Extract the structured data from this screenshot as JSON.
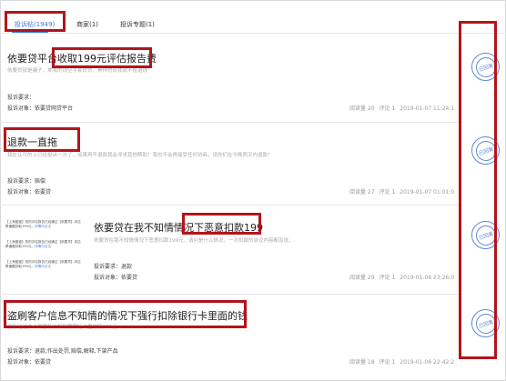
{
  "tabs": [
    {
      "label": "投诉帖(1949)",
      "active": true
    },
    {
      "label": "商家(1)",
      "active": false
    },
    {
      "label": "投诉专题(1)",
      "active": false
    }
  ],
  "complaints": [
    {
      "title": "依要贷平台收取199元评估报告费",
      "summary": "依要贷就是骗子，拿我的钱空手套白贷，骨样的说我就不给退钱",
      "demand": "投诉要求：",
      "target": "投诉对象：依要贷网贷平台",
      "views": "阅读量 20",
      "comments": "评论 1",
      "time": "2019-01-07 11:24:1",
      "stamp": "已回复"
    },
    {
      "title": "退款一直拖",
      "summary": "我在认可的上已经投诉一次了，如果再不退款我会寻求其他帮助！我也不会再接受任何协商，请你们在今晚两天内退款！",
      "demand": "投诉要求：赔偿",
      "target": "投诉对象：依要贷",
      "views": "阅读量 27",
      "comments": "评论 1",
      "time": "2019-01-07 01:01:0",
      "stamp": "已回复"
    },
    {
      "title": "依要贷在我不知情情况下恶意扣款199",
      "summary": "依要贷在我不知情情况下恶意扣款199元，请问是什么情况，一次扣款的协议内容都没说，",
      "demand": "投诉要求：退款",
      "target": "投诉对象：依要贷",
      "views": "阅读量 29",
      "comments": "评论 1",
      "time": "2019-01-06 23:26:0",
      "stamp": "已回复",
      "thumb_lines": [
        {
          "text": "【上海盈盛】您的评估报告已经通过【依要贷】评估平台在",
          "link": ""
        },
        {
          "text": "户卡内扣取199元，",
          "link": "详情可点击"
        },
        {
          "text": "【上海盈盛】您的评估报告已经通过【依要贷】评估平台在",
          "link": ""
        },
        {
          "text": "户卡内扣取199元，",
          "link": "详情可点击"
        },
        {
          "text": "【上海盈盛】您的评估报告已经通过【依要贷】评估平台在",
          "link": ""
        },
        {
          "text": "户卡内扣取199元，",
          "link": "详情可点击"
        }
      ]
    },
    {
      "title": "盗刷客户信息不知情的情况下强行扣除银行卡里面的钱",
      "summary": "没有经过本人同意私自扣除我银行卡里的钱199元",
      "demand": "投诉要求：退款,作出处罚,赔偿,解释,下架产品",
      "target": "投诉对象：依要贷",
      "views": "阅读量 18",
      "comments": "评论 1",
      "time": "2019-01-06 22:42:2",
      "stamp": "已回复"
    }
  ],
  "colors": {
    "accent": "#3a7be0",
    "highlight": "#b3141b",
    "stamp": "#5c89d8"
  }
}
